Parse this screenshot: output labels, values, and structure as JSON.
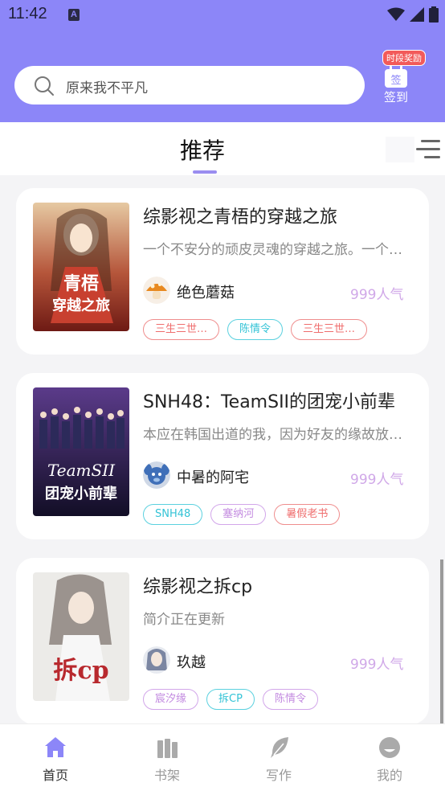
{
  "status_bar": {
    "time": "11:42",
    "notification_letter": "A"
  },
  "header": {
    "search": {
      "placeholder": "原来我不平凡"
    },
    "checkin": {
      "badge": "时段奖励",
      "label": "签到",
      "icon_text": "签"
    }
  },
  "tabs": {
    "active": "推荐"
  },
  "books": [
    {
      "title": "综影视之青梧的穿越之旅",
      "description": "一个不安分的顽皮灵魂的穿越之旅。一个…",
      "author": "绝色蘑菇",
      "popularity": "999人气",
      "tags": [
        {
          "label": "三生三世…",
          "color": "red"
        },
        {
          "label": "陈情令",
          "color": "cyan"
        },
        {
          "label": "三生三世…",
          "color": "red"
        }
      ],
      "cover_colors": [
        "#d9b28a",
        "#8a2a1e"
      ]
    },
    {
      "title": "SNH48：TeamSII的团宠小前辈",
      "description": "本应在韩国出道的我，因为好友的缘故放…",
      "author": "中暑的阿宅",
      "popularity": "999人气",
      "tags": [
        {
          "label": "SNH48",
          "color": "cyan"
        },
        {
          "label": "塞纳河",
          "color": "purple"
        },
        {
          "label": "暑假老书",
          "color": "red"
        }
      ],
      "cover_colors": [
        "#3a2a6a",
        "#1a1436"
      ]
    },
    {
      "title": "综影视之拆cp",
      "description": "简介正在更新",
      "author": "玖越",
      "popularity": "999人气",
      "tags": [
        {
          "label": "宸汐缘",
          "color": "purple"
        },
        {
          "label": "拆CP",
          "color": "cyan"
        },
        {
          "label": "陈情令",
          "color": "purple"
        }
      ],
      "cover_colors": [
        "#e8e6e4",
        "#b8292e"
      ]
    }
  ],
  "bottom_nav": [
    {
      "label": "首页",
      "icon": "home-icon",
      "active": true
    },
    {
      "label": "书架",
      "icon": "bookshelf-icon",
      "active": false
    },
    {
      "label": "写作",
      "icon": "feather-icon",
      "active": false
    },
    {
      "label": "我的",
      "icon": "profile-icon",
      "active": false
    }
  ],
  "colors": {
    "accent": "#8c86f8",
    "popularity": "#d0a8e8"
  }
}
